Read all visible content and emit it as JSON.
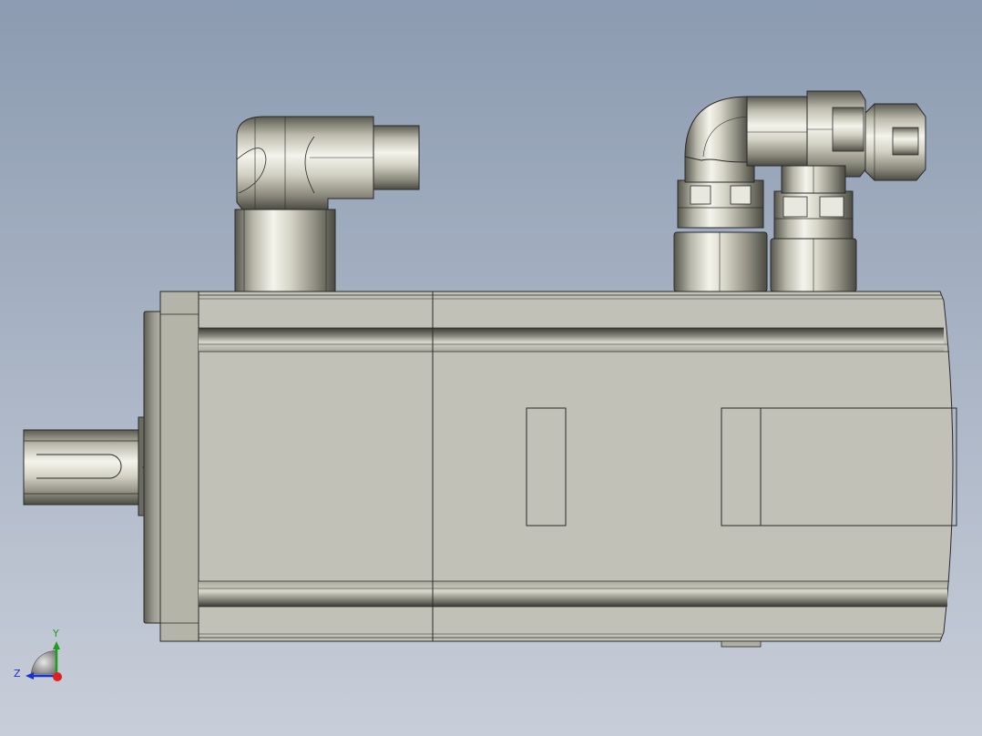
{
  "viewport": {
    "background_top": "#8c9bb1",
    "background_bottom": "#c8ced9"
  },
  "model": {
    "body_color": "#c2c1b7",
    "edge_color": "#2a2a2a",
    "metal_light": "#f2f2ea",
    "metal_dark": "#4a4a44"
  },
  "triad": {
    "y_label": "Y",
    "z_label": "Z",
    "y_color": "#1aa01a",
    "z_color": "#1a2fd0",
    "x_color": "#e02020"
  }
}
